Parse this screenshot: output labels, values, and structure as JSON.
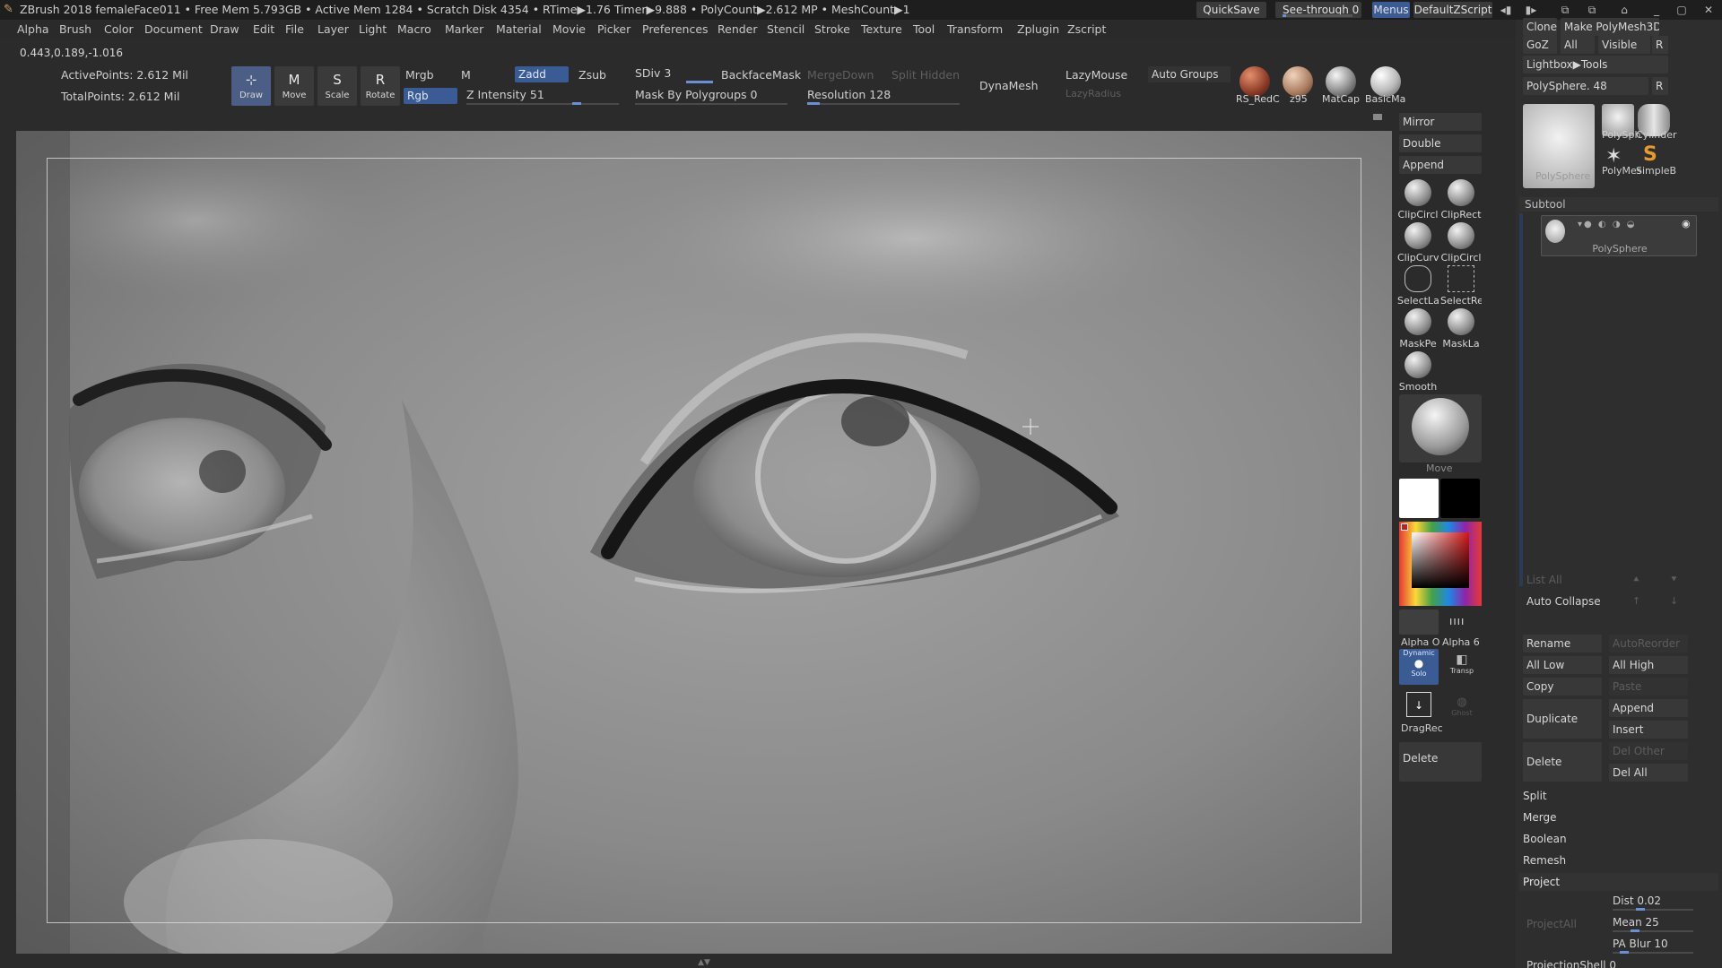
{
  "titlebar": {
    "info": "ZBrush 2018   femaleFace011   • Free Mem 5.793GB • Active Mem 1284 • Scratch Disk 4354 •  RTime▶1.76 Timer▶9.888 • PolyCount▶2.612 MP  • MeshCount▶1",
    "quicksave": "QuickSave",
    "see_through": "See-through  0",
    "menus": "Menus",
    "default_zscript": "DefaultZScript"
  },
  "menubar": [
    "Alpha",
    "Brush",
    "Color",
    "Document",
    "Draw",
    "Edit",
    "File",
    "Layer",
    "Light",
    "Macro",
    "Marker",
    "Material",
    "Movie",
    "Picker",
    "Preferences",
    "Render",
    "Stencil",
    "Stroke",
    "Texture",
    "Tool",
    "Transform",
    "Zplugin",
    "Zscript"
  ],
  "coords": "0.443,0.189,-1.016",
  "shelf": {
    "active_points": "ActivePoints: 2.612 Mil",
    "total_points": "TotalPoints: 2.612 Mil",
    "tools": [
      "Draw",
      "Move",
      "Scale",
      "Rotate"
    ],
    "mrgb": "Mrgb",
    "rgb": "Rgb",
    "m": "M",
    "zadd": "Zadd",
    "zsub": "Zsub",
    "z_intensity": "Z Intensity 51",
    "sdiv": "SDiv 3",
    "backface_mask": "BackfaceMask",
    "merge_down": "MergeDown",
    "split_hidden": "Split Hidden",
    "mask_by_polygroups": "Mask By Polygroups 0",
    "resolution": "Resolution 128",
    "dynamesh": "DynaMesh",
    "lazymouse": "LazyMouse",
    "lazyradius": "LazyRadius",
    "auto_groups": "Auto Groups",
    "materials": [
      "RS_RedC",
      "z95",
      "MatCap",
      "BasicMa"
    ]
  },
  "toolcol": {
    "mirror": "Mirror",
    "double": "Double",
    "append": "Append",
    "icons": [
      "ClipCircl",
      "ClipRect",
      "ClipCurv",
      "ClipCircl",
      "SelectLa",
      "SelectRe",
      "MaskPe",
      "MaskLa",
      "Smooth"
    ],
    "move_brush": "Move",
    "alpha_off": "Alpha O",
    "alpha_6": "Alpha 6",
    "dynamic": "Dynamic",
    "solo": "Solo",
    "transp": "Transp",
    "dragrect": "DragRec",
    "ghost": "Ghost",
    "delete": "Delete"
  },
  "palette": {
    "clone": "Clone",
    "make_polymesh": "Make PolyMesh3D",
    "goz": "GoZ",
    "all": "All",
    "visible": "Visible",
    "r": "R",
    "lightbox_tools": "Lightbox▶Tools",
    "polysphere": "PolySphere. 48",
    "thumbs": [
      "PolySphere",
      "PolySph",
      "Cylinder",
      "PolyMes",
      "SimpleB"
    ],
    "subtool": "Subtool",
    "subtool_item": "PolySphere",
    "list_all": "List All",
    "auto_collapse": "Auto Collapse",
    "rename": "Rename",
    "auto_reorder": "AutoReorder",
    "all_low": "All Low",
    "all_high": "All High",
    "copy": "Copy",
    "paste": "Paste",
    "duplicate": "Duplicate",
    "append": "Append",
    "insert": "Insert",
    "delete": "Delete",
    "del_other": "Del Other",
    "del_all": "Del All",
    "split": "Split",
    "merge": "Merge",
    "boolean": "Boolean",
    "remesh": "Remesh",
    "project": "Project",
    "project_all": "ProjectAll",
    "dist": "Dist 0.02",
    "mean": "Mean 25",
    "pa_blur": "PA Blur 10",
    "projection_shell": "ProjectionShell 0"
  }
}
